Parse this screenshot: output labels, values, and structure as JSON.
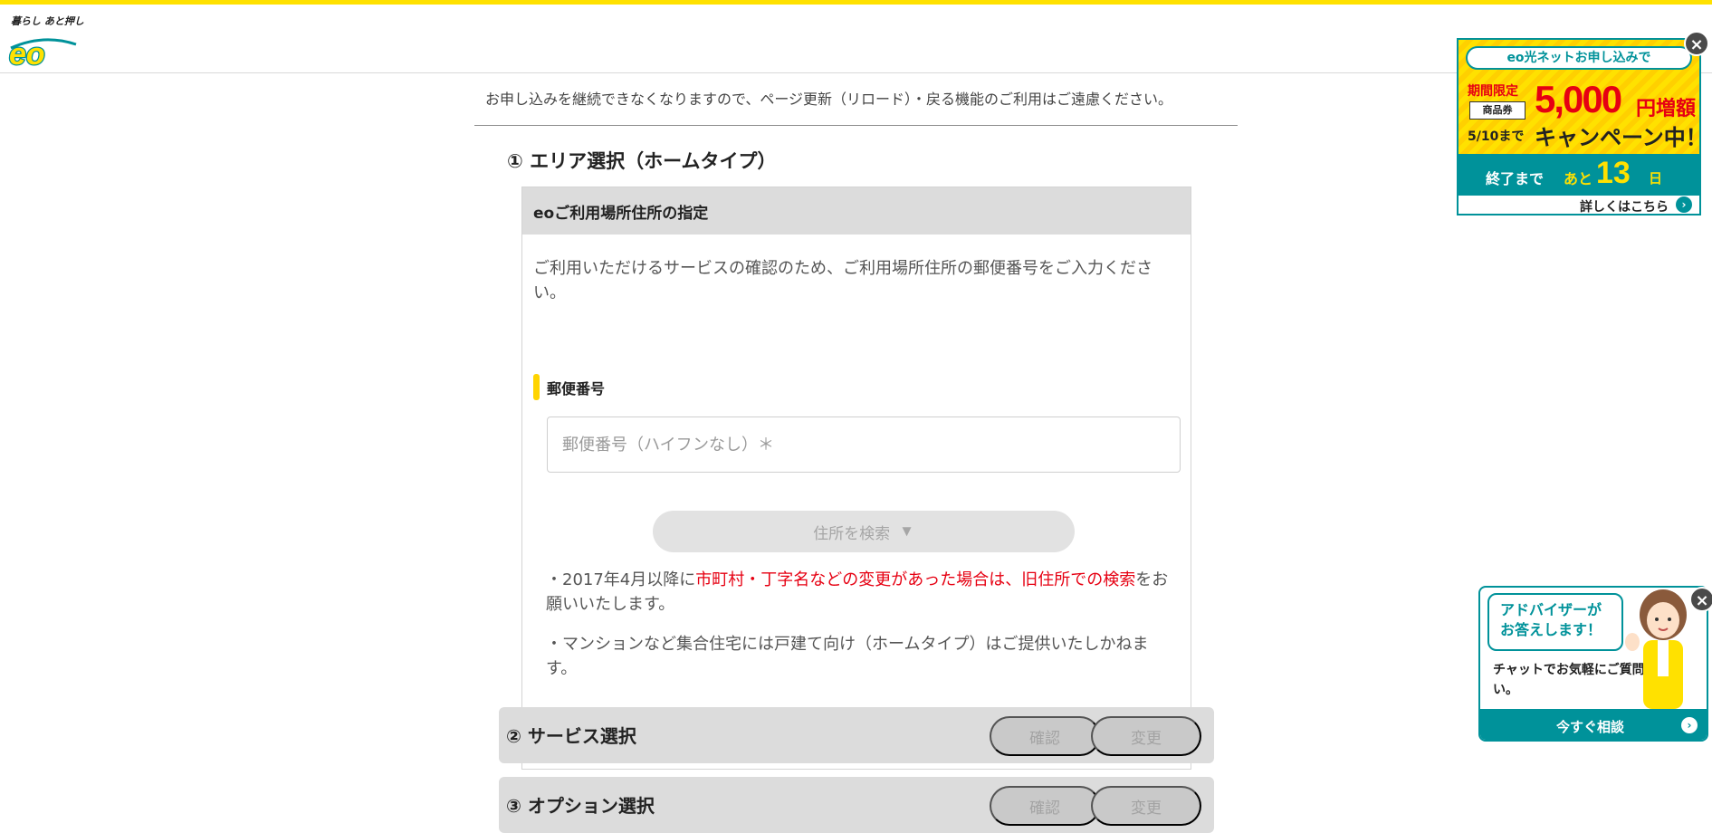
{
  "header": {
    "logo_tagline": "暮らし あと押し",
    "logo_text": "eo"
  },
  "notice": "お申し込みを継続できなくなりますので、ページ更新（リロード）・戻る機能のご利用はご遠慮ください。",
  "step1": {
    "title": "① エリア選択（ホームタイプ）",
    "card_title": "eoご利用場所住所の指定",
    "description": "ご利用いただけるサービスの確認のため、ご利用場所住所の郵便番号をご入力ください。",
    "zip_label": "郵便番号",
    "zip_placeholder": "郵便番号（ハイフンなし）＊",
    "zip_value": "",
    "search_button": "住所を検索",
    "search_button_arrow": "▼",
    "note1_prefix": "・2017年4月以降に",
    "note1_red": "市町村・丁字名などの変更があった場合は、旧住所での検索",
    "note1_suffix": "をお願いいたします。",
    "note2": "・マンションなど集合住宅には戸建て向け（ホームタイプ）はご提供いたしかねます。"
  },
  "step2": {
    "title": "② サービス選択",
    "confirm": "確認",
    "change": "変更"
  },
  "step3": {
    "title": "③ オプション選択",
    "confirm": "確認",
    "change": "変更"
  },
  "banner": {
    "headline": "eo光ネットお申し込みで",
    "limited": "期間限定",
    "coupon": "商品券",
    "until": "5/10まで",
    "amount": "5,000",
    "amount_suffix": "円増額",
    "campaign": "キャンペーン中！",
    "end_label": "終了まで",
    "ato": "あと",
    "days": "13",
    "day_unit": "日",
    "details": "詳しくはこちら",
    "close": "×"
  },
  "chat": {
    "bubble": "アドバイザーがお答えします！",
    "text": "チャットでお気軽にご質問ください。",
    "button": "今すぐ相談",
    "close": "×"
  },
  "colors": {
    "accent_yellow": "#ffe100",
    "teal": "#00929a",
    "red": "#e60012"
  }
}
